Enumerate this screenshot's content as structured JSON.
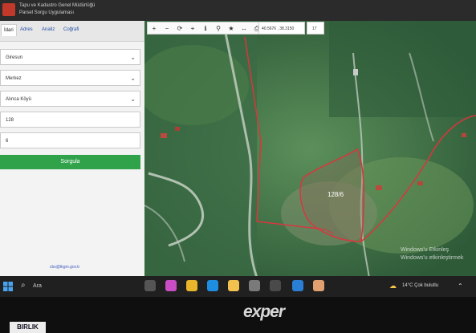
{
  "header": {
    "line1": "Tapu ve Kadastro Genel Müdürlüğü",
    "line2": "Parsel Sorgu Uygulaması"
  },
  "tabs": [
    "İdari",
    "Adres",
    "Analiz",
    "Coğrafi"
  ],
  "form": {
    "il": "Giresun",
    "ilce": "Merkez",
    "mahalle": "Alınca Köyü",
    "ada": "128",
    "parsel": "6",
    "query_label": "Sorgula"
  },
  "footer_email": "cbs@tkgm.gov.tr",
  "toolbar": {
    "coords": "40.5676 , 38.3150",
    "zoom": "17"
  },
  "map": {
    "parcel_label": "128/6"
  },
  "watermark": {
    "line1": "Windows'u Etkinleş",
    "line2": "Windows'u etkinleştirmek"
  },
  "taskbar": {
    "search_label": "Ara",
    "temperature": "14°C",
    "weather_desc": "Çok bulutlu"
  },
  "monitor": {
    "brand": "exper",
    "sticker": "BIRLIK"
  },
  "colors": {
    "accent_green": "#2fa24a",
    "parcel_line": "#d9363e",
    "header_red": "#c0392b"
  }
}
